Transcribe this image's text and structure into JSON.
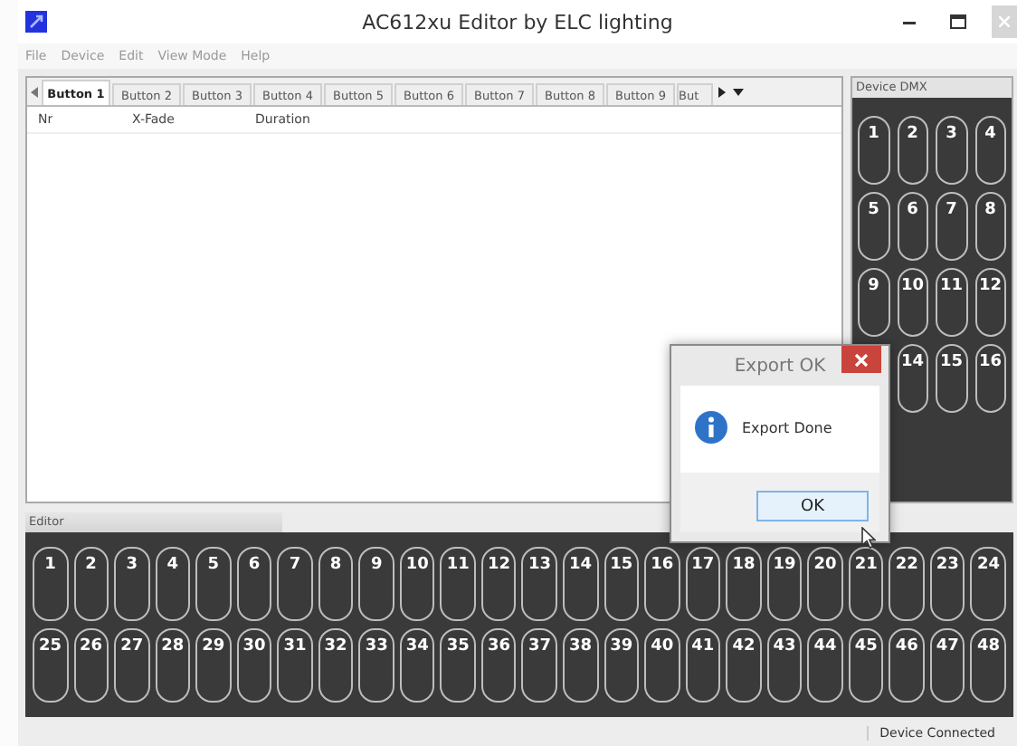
{
  "window": {
    "title": "AC612xu Editor by ELC lighting"
  },
  "menu": [
    "File",
    "Device",
    "Edit",
    "View Mode",
    "Help"
  ],
  "tabs": [
    {
      "label": "Button 1",
      "selected": true
    },
    {
      "label": "Button 2",
      "selected": false
    },
    {
      "label": "Button 3",
      "selected": false
    },
    {
      "label": "Button 4",
      "selected": false
    },
    {
      "label": "Button 5",
      "selected": false
    },
    {
      "label": "Button 6",
      "selected": false
    },
    {
      "label": "Button 7",
      "selected": false
    },
    {
      "label": "Button 8",
      "selected": false
    },
    {
      "label": "Button 9",
      "selected": false
    },
    {
      "label": "But",
      "selected": false
    }
  ],
  "table": {
    "columns": [
      "Nr",
      "X-Fade",
      "Duration"
    ]
  },
  "device_dmx": {
    "title": "Device DMX",
    "pads": [
      "1",
      "2",
      "3",
      "4",
      "5",
      "6",
      "7",
      "8",
      "9",
      "10",
      "11",
      "12",
      "14",
      "15",
      "16"
    ]
  },
  "editor": {
    "title": "Editor",
    "pads": [
      "1",
      "2",
      "3",
      "4",
      "5",
      "6",
      "7",
      "8",
      "9",
      "10",
      "11",
      "12",
      "13",
      "14",
      "15",
      "16",
      "17",
      "18",
      "19",
      "20",
      "21",
      "22",
      "23",
      "24",
      "25",
      "26",
      "27",
      "28",
      "29",
      "30",
      "31",
      "32",
      "33",
      "34",
      "35",
      "36",
      "37",
      "38",
      "39",
      "40",
      "41",
      "42",
      "43",
      "44",
      "45",
      "46",
      "47",
      "48"
    ]
  },
  "dialog": {
    "title": "Export OK",
    "message": "Export Done",
    "button": "OK"
  },
  "status_bar": "Device Connected"
}
